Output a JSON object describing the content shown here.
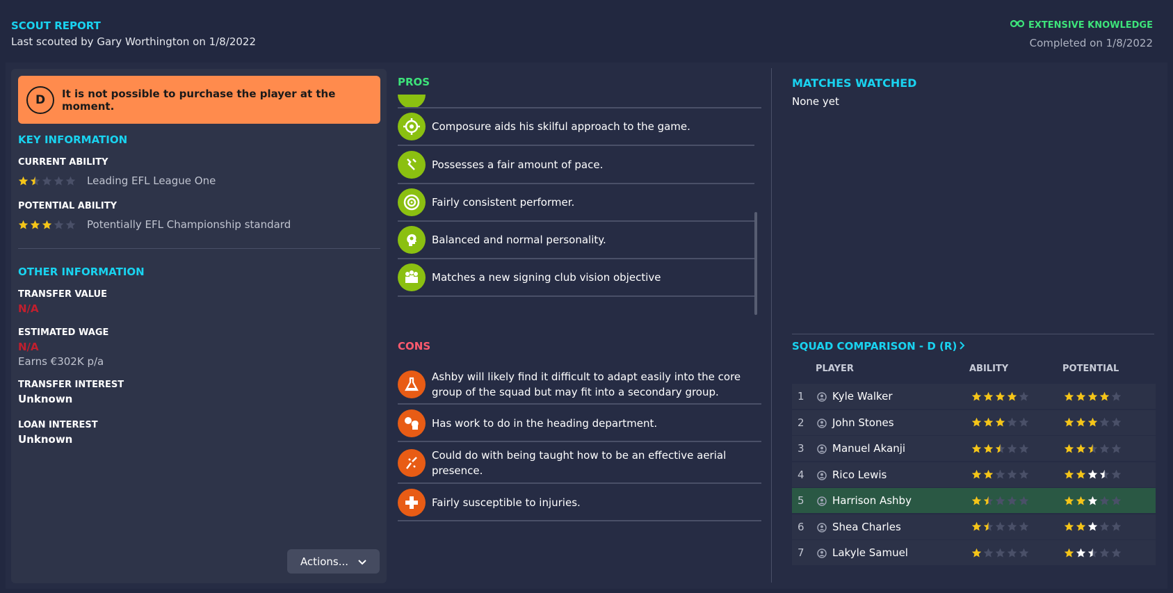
{
  "header": {
    "title": "SCOUT REPORT",
    "subtitle": "Last scouted by Gary Worthington on 1/8/2022",
    "knowledge": "EXTENSIVE KNOWLEDGE",
    "completed": "Completed on 1/8/2022"
  },
  "alert": {
    "badge": "D",
    "text": "It is not possible to purchase the player at the moment."
  },
  "key_info": {
    "title": "KEY INFORMATION",
    "current_ability": {
      "label": "CURRENT ABILITY",
      "stars": 1.5,
      "desc": "Leading EFL League One"
    },
    "potential_ability": {
      "label": "POTENTIAL ABILITY",
      "stars": 3,
      "potential_stars": 3,
      "desc": "Potentially EFL Championship standard"
    }
  },
  "other_info": {
    "title": "OTHER INFORMATION",
    "transfer_value_label": "TRANSFER VALUE",
    "transfer_value": "N/A",
    "estimated_wage_label": "ESTIMATED WAGE",
    "estimated_wage": "N/A",
    "earns": "Earns €302K p/a",
    "transfer_interest_label": "TRANSFER INTEREST",
    "transfer_interest": "Unknown",
    "loan_interest_label": "LOAN INTEREST",
    "loan_interest": "Unknown"
  },
  "actions_label": "Actions...",
  "pros": {
    "title": "PROS",
    "items": [
      {
        "icon": "composure-icon",
        "text": "Composure aids his skilful approach to the game."
      },
      {
        "icon": "pace-icon",
        "text": "Possesses a fair amount of pace."
      },
      {
        "icon": "target-icon",
        "text": "Fairly consistent performer."
      },
      {
        "icon": "personality-icon",
        "text": "Balanced and normal personality."
      },
      {
        "icon": "club-vision-icon",
        "text": "Matches a new signing club vision objective"
      }
    ]
  },
  "cons": {
    "title": "CONS",
    "items": [
      {
        "icon": "flask-icon",
        "text": "Ashby will likely find it difficult to adapt easily into the core group of the squad but may fit into a secondary group."
      },
      {
        "icon": "heading-icon",
        "text": "Has work to do in the heading department."
      },
      {
        "icon": "aerial-icon",
        "text": "Could do with being taught how to be an effective aerial presence."
      },
      {
        "icon": "injury-icon",
        "text": "Fairly susceptible to injuries."
      }
    ]
  },
  "matches": {
    "title": "MATCHES WATCHED",
    "value": "None yet"
  },
  "squad": {
    "title": "SQUAD COMPARISON - D (R)",
    "headers": {
      "player": "PLAYER",
      "ability": "ABILITY",
      "potential": "POTENTIAL"
    },
    "rows": [
      {
        "num": "1",
        "name": "Kyle Walker",
        "ability": 4,
        "potential": 4,
        "potential_max": 4,
        "highlight": false
      },
      {
        "num": "2",
        "name": "John Stones",
        "ability": 3,
        "potential": 3,
        "potential_max": 3,
        "highlight": false
      },
      {
        "num": "3",
        "name": "Manuel Akanji",
        "ability": 2.5,
        "potential": 2.5,
        "potential_max": 2.5,
        "highlight": false
      },
      {
        "num": "4",
        "name": "Rico Lewis",
        "ability": 2,
        "potential": 2,
        "potential_max": 3.5,
        "highlight": false
      },
      {
        "num": "5",
        "name": "Harrison Ashby",
        "ability": 1.5,
        "potential": 2,
        "potential_max": 3,
        "highlight": true
      },
      {
        "num": "6",
        "name": "Shea Charles",
        "ability": 1.5,
        "potential": 2,
        "potential_max": 3,
        "highlight": false
      },
      {
        "num": "7",
        "name": "Lakyle Samuel",
        "ability": 1,
        "potential": 1,
        "potential_max": 2.5,
        "highlight": false
      }
    ]
  },
  "colors": {
    "accent": "#19d3f0",
    "pro": "#8bc011",
    "con": "#e85c15",
    "alert": "#ff8b4d",
    "star_gold": "#f5c518",
    "star_white": "#ffffff",
    "na": "#c11f2e",
    "highlight": "#2a5844"
  }
}
